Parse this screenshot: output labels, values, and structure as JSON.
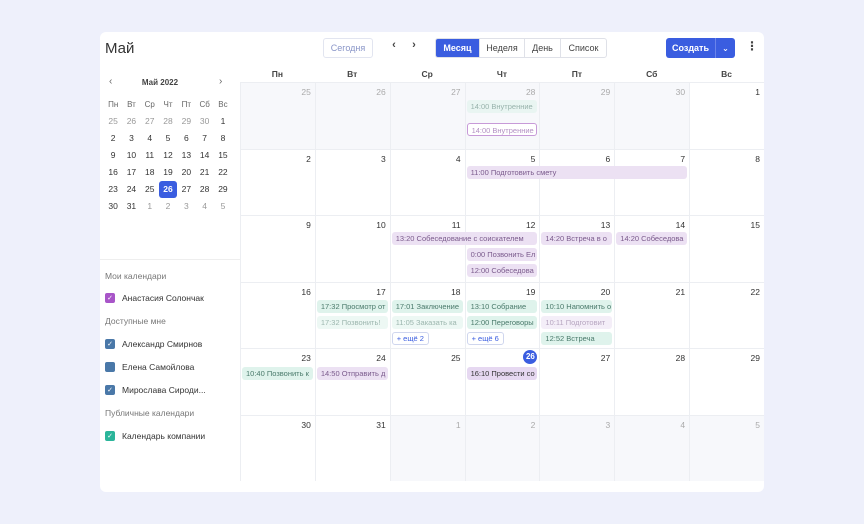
{
  "header": {
    "title": "Май",
    "today": "Сегодня",
    "prev": "‹",
    "next": "›",
    "views": [
      "Месяц",
      "Неделя",
      "День",
      "Список"
    ],
    "create": "Создать",
    "create_dropdown": "⌄",
    "more": "⋮"
  },
  "mini": {
    "month": "Май 2022",
    "prev": "‹",
    "next": "›",
    "weekdays": [
      "Пн",
      "Вт",
      "Ср",
      "Чт",
      "Пт",
      "Сб",
      "Вс"
    ],
    "weeks": [
      [
        "25",
        "26",
        "27",
        "28",
        "29",
        "30",
        "1"
      ],
      [
        "2",
        "3",
        "4",
        "5",
        "6",
        "7",
        "8"
      ],
      [
        "9",
        "10",
        "11",
        "12",
        "13",
        "14",
        "15"
      ],
      [
        "16",
        "17",
        "18",
        "19",
        "20",
        "21",
        "22"
      ],
      [
        "23",
        "24",
        "25",
        "26",
        "27",
        "28",
        "29"
      ],
      [
        "30",
        "31",
        "1",
        "2",
        "3",
        "4",
        "5"
      ]
    ]
  },
  "calendars": {
    "my_title": "Мои календари",
    "my": [
      {
        "label": "Анастасия Солончак",
        "color": "#a855c8",
        "checked": true
      }
    ],
    "avail_title": "Доступные мне",
    "avail": [
      {
        "label": "Александр Смирнов",
        "color": "#4a78a8",
        "checked": true
      },
      {
        "label": "Елена Самойлова",
        "color": "#4a78a8",
        "checked": false
      },
      {
        "label": "Мирослава Сироди...",
        "color": "#4a78a8",
        "checked": true
      }
    ],
    "public_title": "Публичные календари",
    "public": [
      {
        "label": "Календарь компании",
        "color": "#2bb59a",
        "checked": true
      }
    ]
  },
  "month": {
    "weekdays": [
      "Пн",
      "Вт",
      "Ср",
      "Чт",
      "Пт",
      "Сб",
      "Вс"
    ],
    "weeks": [
      [
        "25",
        "26",
        "27",
        "28",
        "29",
        "30",
        "1"
      ],
      [
        "2",
        "3",
        "4",
        "5",
        "6",
        "7",
        "8"
      ],
      [
        "9",
        "10",
        "11",
        "12",
        "13",
        "14",
        "15"
      ],
      [
        "16",
        "17",
        "18",
        "19",
        "20",
        "21",
        "22"
      ],
      [
        "23",
        "24",
        "25",
        "26",
        "27",
        "28",
        "29"
      ],
      [
        "30",
        "31",
        "1",
        "2",
        "3",
        "4",
        "5"
      ]
    ],
    "today": "26",
    "events": {
      "w0_thu_1": "14:00 Внутренние",
      "w0_thu_2": "14:00 Внутренние",
      "w1_thu": "11:00 Подготовить смету",
      "w2_wed": "13:20 Собеседование с соискателем",
      "w2_fri": "14:20 Встреча в о",
      "w2_sat": "14:20 Собеседова",
      "w2_thu_2": "0:00 Позвонить Ел",
      "w2_thu_3": "12:00 Собеседова",
      "w3_tue_1": "17:32 Просмотр от",
      "w3_tue_2": "17:32 Позвонить!",
      "w3_wed_1": "17:01 Заключение",
      "w3_wed_2": "11:05 Заказать ка",
      "w3_wed_more": "+ ещё 2",
      "w3_thu_1": "13:10 Собрание",
      "w3_thu_2": "12:00 Переговоры",
      "w3_thu_more": "+ ещё 6",
      "w3_fri_1": "10:10 Напомнить о",
      "w3_fri_2": "10:11 Подготовит",
      "w3_fri_3": "12:52 Встреча",
      "w4_mon": "10:40 Позвонить к",
      "w4_tue": "14:50 Отправить д",
      "w4_thu": "16:10 Провести со"
    }
  }
}
